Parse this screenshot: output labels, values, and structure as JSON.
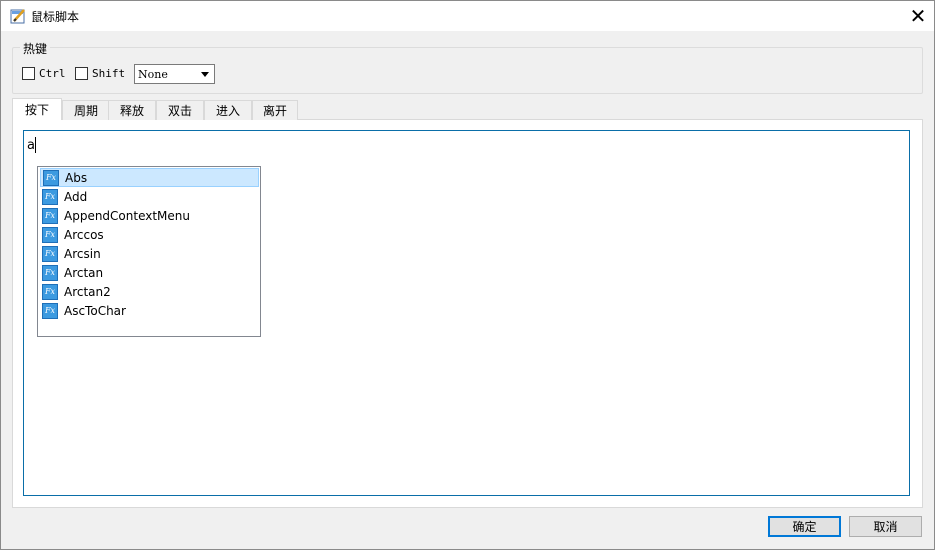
{
  "window": {
    "title": "鼠标脚本",
    "close_glyph": "✕"
  },
  "hotkey": {
    "group_label": "热键",
    "ctrl_label": "Ctrl",
    "shift_label": "Shift",
    "key_select_value": "None"
  },
  "tabs": [
    {
      "label": "按下",
      "active": true
    },
    {
      "label": "周期",
      "active": false
    },
    {
      "label": "释放",
      "active": false
    },
    {
      "label": "双击",
      "active": false
    },
    {
      "label": "进入",
      "active": false
    },
    {
      "label": "离开",
      "active": false
    }
  ],
  "editor": {
    "text": "a"
  },
  "autocomplete": {
    "icon_text": "Fx",
    "items": [
      "Abs",
      "Add",
      "AppendContextMenu",
      "Arccos",
      "Arcsin",
      "Arctan",
      "Arctan2",
      "AscToChar"
    ],
    "selected_index": 0
  },
  "footer": {
    "ok_label": "确定",
    "cancel_label": "取消"
  },
  "colors": {
    "accent": "#0078d7",
    "selection": "#cce8ff",
    "fx_icon": "#3c9ae0"
  }
}
